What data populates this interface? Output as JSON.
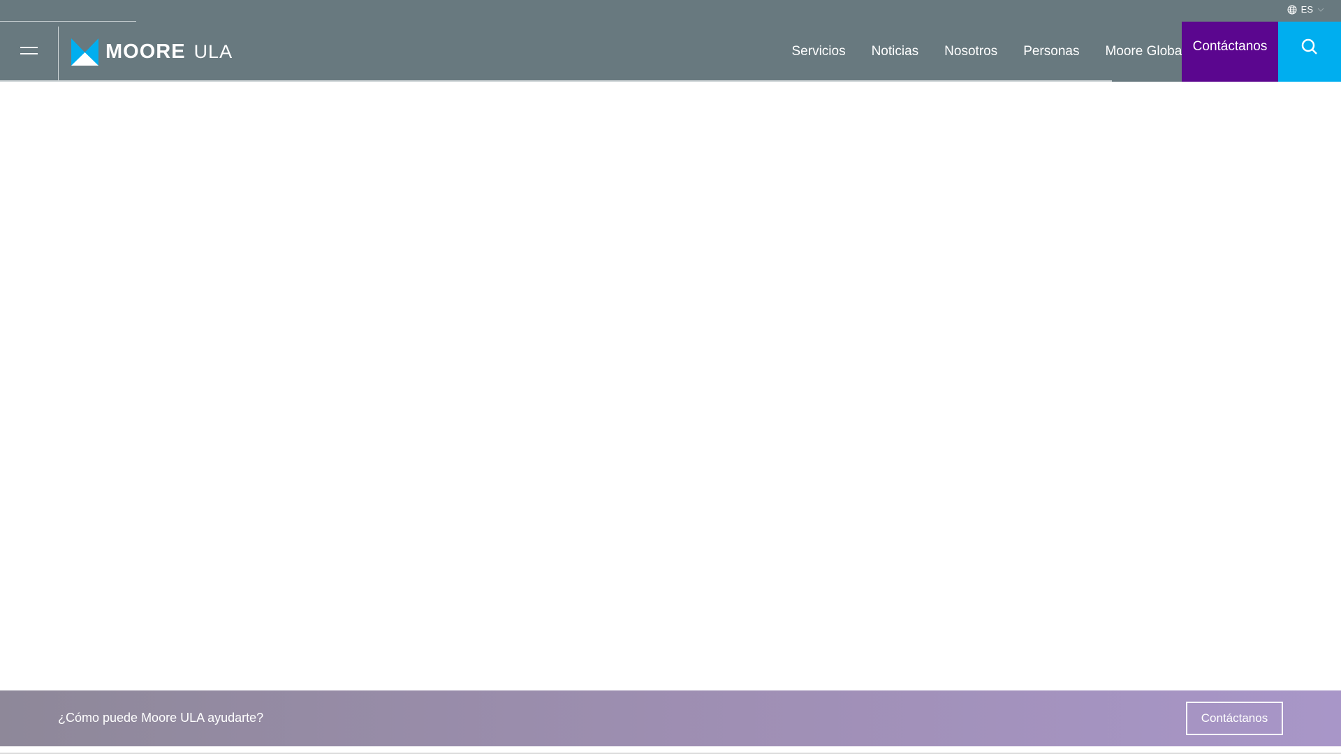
{
  "header": {
    "language": "ES",
    "logo_text": "MOORE",
    "logo_sub": "ULA",
    "nav": [
      "Servicios",
      "Noticias",
      "Nosotros",
      "Personas",
      "Moore Global"
    ],
    "contact_label": "Contáctanos"
  },
  "cta": {
    "question": "¿Cómo puede Moore ULA ayudarte?",
    "button_label": "Contáctanos"
  },
  "colors": {
    "header": "#68797f",
    "contact": "#5b068f",
    "search": "#00aeef"
  }
}
